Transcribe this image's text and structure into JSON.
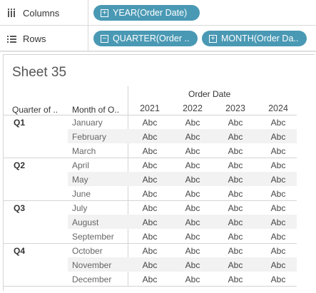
{
  "shelves": {
    "columns": {
      "label": "Columns",
      "icon": "columns-icon",
      "pills": [
        {
          "label": "YEAR(Order Date)",
          "icon": "plus-box-icon"
        }
      ]
    },
    "rows": {
      "label": "Rows",
      "icon": "rows-icon",
      "pills": [
        {
          "label": "QUARTER(Order ..",
          "icon": "minus-box-icon"
        },
        {
          "label": "MONTH(Order Da..",
          "icon": "plus-box-icon"
        }
      ]
    }
  },
  "sheet": {
    "title": "Sheet 35",
    "column_group_header": "Order Date",
    "row_headers": [
      "Quarter of ..",
      "Month of O.."
    ],
    "years": [
      "2021",
      "2022",
      "2023",
      "2024"
    ],
    "cell_text": "Abc",
    "quarters": [
      {
        "label": "Q1",
        "months": [
          "January",
          "February",
          "March"
        ]
      },
      {
        "label": "Q2",
        "months": [
          "April",
          "May",
          "June"
        ]
      },
      {
        "label": "Q3",
        "months": [
          "July",
          "August",
          "September"
        ]
      },
      {
        "label": "Q4",
        "months": [
          "October",
          "November",
          "December"
        ]
      }
    ]
  },
  "colors": {
    "pill": "#4a99b4",
    "band": "#f2f2f2",
    "grid": "#d4d4d4"
  }
}
